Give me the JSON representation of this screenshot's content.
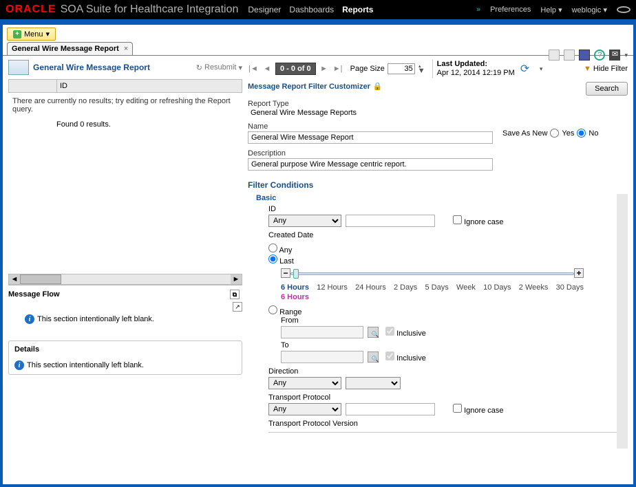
{
  "header": {
    "brand": "ORACLE",
    "appTitle": "SOA Suite for Healthcare Integration",
    "nav": {
      "designer": "Designer",
      "dashboards": "Dashboards",
      "reports": "Reports"
    },
    "prefs": "Preferences",
    "help": "Help",
    "user": "weblogic"
  },
  "menuBtn": "Menu",
  "docTab": "General Wire Message Report",
  "report": {
    "title": "General Wire Message Report",
    "resubmit": "Resubmit",
    "pageInfo": "0 - 0 of 0",
    "pageSizeLabel": "Page Size",
    "pageSize": "35",
    "lastUpdatedLabel": "Last Updated:",
    "lastUpdated": "Apr 12, 2014 12:19 PM",
    "hideFilter": "Hide Filter"
  },
  "results": {
    "idHeader": "ID",
    "noResults": "There are currently no results; try editing or refreshing the Report query.",
    "found": "Found 0 results."
  },
  "messageFlow": {
    "title": "Message Flow",
    "blank": "This section intentionally left blank."
  },
  "details": {
    "title": "Details",
    "blank": "This section intentionally left blank."
  },
  "filter": {
    "title": "Message Report Filter Customizer",
    "search": "Search",
    "reportTypeLabel": "Report Type",
    "reportType": "General Wire Message Reports",
    "nameLabel": "Name",
    "name": "General Wire Message Report",
    "saveAsNew": "Save As New",
    "yes": "Yes",
    "no": "No",
    "descriptionLabel": "Description",
    "description": "General purpose Wire Message centric report.",
    "conditionsTitle": "Filter Conditions",
    "basic": "Basic",
    "idLabel": "ID",
    "anyOpt": "Any",
    "ignoreCase": "Ignore case",
    "createdDate": "Created Date",
    "radioAny": "Any",
    "radioLast": "Last",
    "radioRange": "Range",
    "sliderLabels": [
      "6 Hours",
      "12 Hours",
      "24 Hours",
      "2 Days",
      "5 Days",
      "Week",
      "10 Days",
      "2 Weeks",
      "30 Days"
    ],
    "sliderSelected": "6 Hours",
    "fromLabel": "From",
    "toLabel": "To",
    "inclusive": "Inclusive",
    "directionLabel": "Direction",
    "transportProtoLabel": "Transport Protocol",
    "transportProtoVersionLabel": "Transport Protocol Version"
  }
}
